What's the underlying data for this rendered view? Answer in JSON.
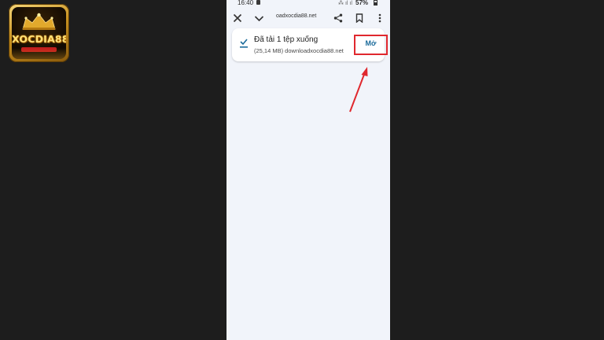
{
  "logo": {
    "text": "XOCDIA88"
  },
  "status_bar": {
    "time": "16:40",
    "battery": "57%"
  },
  "toolbar": {
    "url": "oadxocdia88.net",
    "icons": [
      "close-icon",
      "chevron-down-icon",
      "share-icon",
      "bookmark-icon",
      "more-vert-icon"
    ]
  },
  "download": {
    "title": "Đã tải 1 tệp xuống",
    "subtitle": "(25,14 MB) downloadxocdia88.net",
    "open_label": "Mở"
  },
  "colors": {
    "accent_text": "#1b6b9b",
    "highlight_box": "#e0282e",
    "page_bg": "#1d1d1d",
    "phone_bg": "#f1f4fa"
  }
}
